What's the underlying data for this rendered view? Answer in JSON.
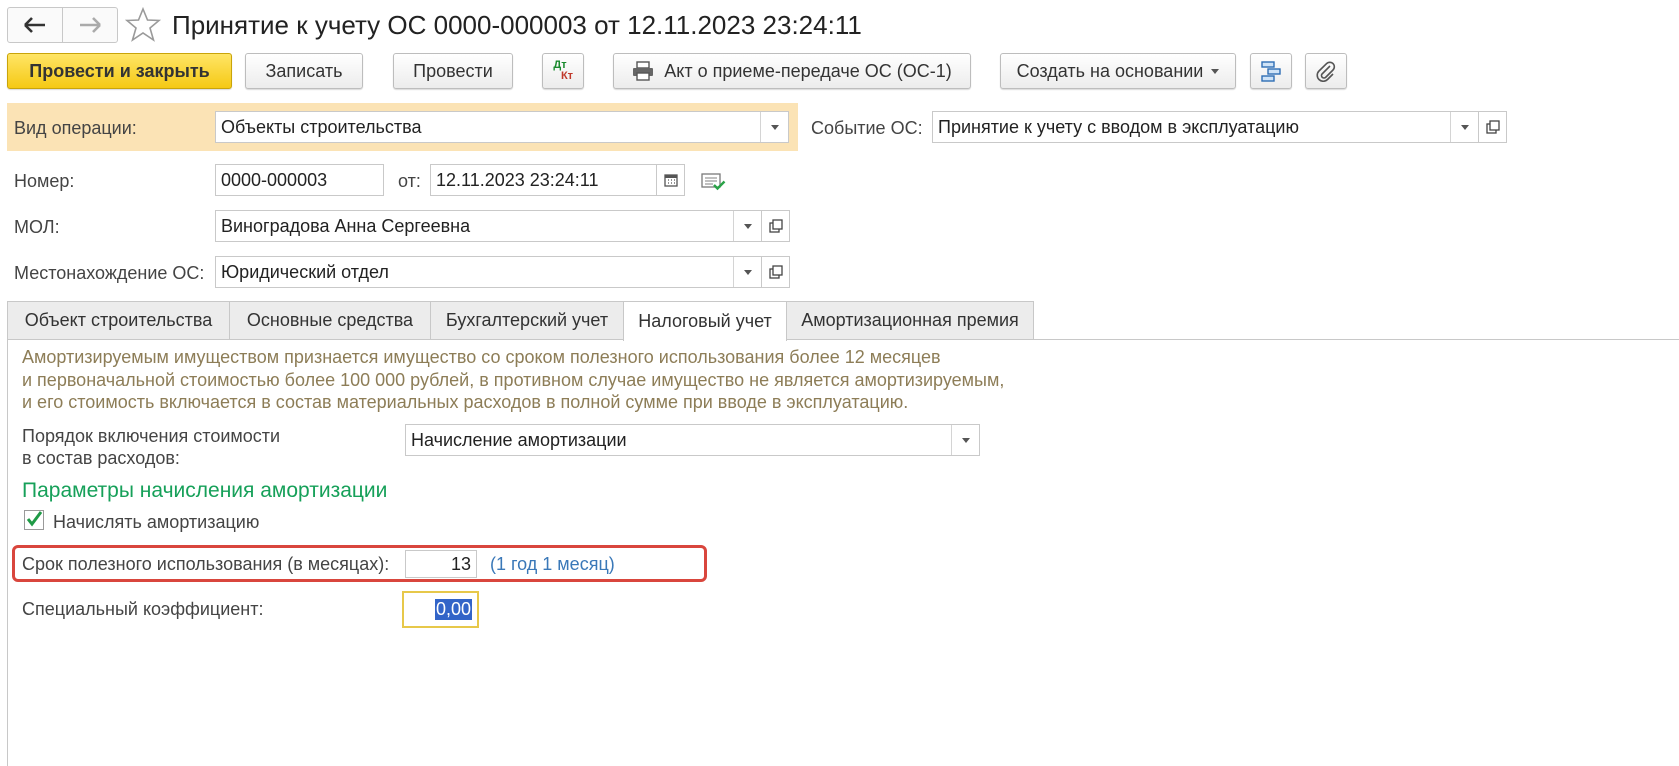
{
  "window": {
    "title": "Принятие к учету ОС 0000-000003 от 12.11.2023 23:24:11"
  },
  "toolbar": {
    "post_close": "Провести и закрыть",
    "save": "Записать",
    "post": "Провести",
    "dtkt_top": "Дт",
    "dtkt_bottom": "Кт",
    "print_act": "Акт о приеме-передаче ОС (ОС-1)",
    "create_based": "Создать на основании"
  },
  "header": {
    "operation_label": "Вид операции:",
    "operation_value": "Объекты строительства",
    "event_label": "Событие ОС:",
    "event_value": "Принятие к учету с вводом в эксплуатацию",
    "number_label": "Номер:",
    "number_value": "0000-000003",
    "date_label": "от:",
    "date_value": "12.11.2023 23:24:11",
    "mol_label": "МОЛ:",
    "mol_value": "Виноградова Анна Сергеевна",
    "location_label": "Местонахождение ОС:",
    "location_value": "Юридический отдел"
  },
  "tabs": [
    {
      "label": "Объект строительства"
    },
    {
      "label": "Основные средства"
    },
    {
      "label": "Бухгалтерский учет"
    },
    {
      "label": "Налоговый учет",
      "active": true
    },
    {
      "label": "Амортизационная премия"
    }
  ],
  "tax": {
    "note_line1": "Амортизируемым имуществом признается имущество со сроком полезного использования более 12 месяцев",
    "note_line2": "и первоначальной стоимостью более 100 000 рублей, в противном случае имущество не является амортизируемым,",
    "note_line3": "и его стоимость включается в состав материальных расходов в полной сумме при вводе в эксплуатацию.",
    "cost_order_label_1": "Порядок включения стоимости",
    "cost_order_label_2": "в состав расходов:",
    "cost_order_value": "Начисление амортизации",
    "section_title": "Параметры начисления амортизации",
    "accrue_label": "Начислять амортизацию",
    "accrue_checked": true,
    "life_label": "Срок полезного использования (в месяцах):",
    "life_value": "13",
    "life_hint": "(1 год 1 месяц)",
    "coef_label": "Специальный коэффициент:",
    "coef_value": "0,00"
  },
  "colors": {
    "primary_button": "#f5c914",
    "operation_band": "#fbe3b5",
    "section_title": "#16a059",
    "note_text": "#8d7d57",
    "link": "#3a78b8",
    "highlight_border": "#d9463d",
    "focus_border": "#e7c84a"
  }
}
